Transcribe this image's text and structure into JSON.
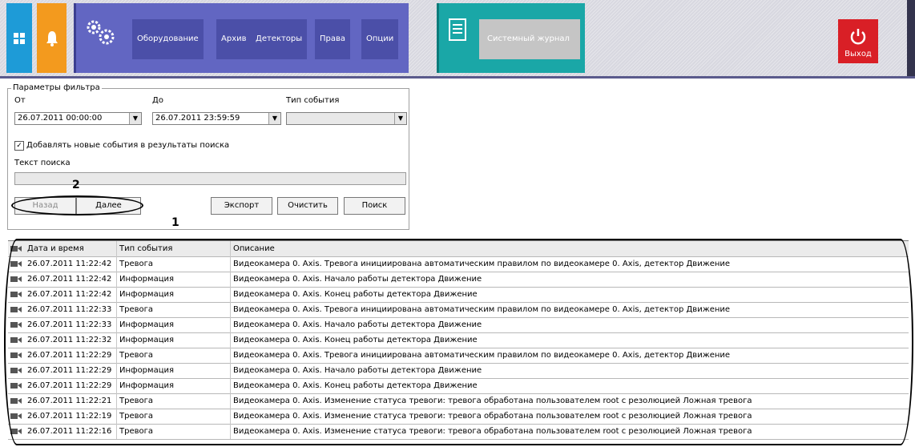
{
  "topbar": {
    "menu": [
      "Оборудование",
      "Архив",
      "Детекторы",
      "Права",
      "Опции"
    ],
    "journal_label": "Системный журнал",
    "exit_label": "Выход",
    "colors": {
      "grid_tile": "#1e9bd7",
      "bell_tile": "#f39a1e",
      "menu_group": "#6266c2",
      "journal_group": "#1aa7a7",
      "exit": "#d91f26"
    }
  },
  "filter": {
    "legend": "Параметры фильтра",
    "from_label": "От",
    "to_label": "До",
    "type_label": "Тип события",
    "from_value": "26.07.2011 00:00:00",
    "to_value": "26.07.2011 23:59:59",
    "type_value": "",
    "append_checked": true,
    "append_label": "Добавлять новые события в результаты поиска",
    "search_label": "Текст поиска",
    "search_value": "",
    "buttons": {
      "back": "Назад",
      "next": "Далее",
      "export": "Экспорт",
      "clear": "Очистить",
      "search": "Поиск"
    }
  },
  "callouts": {
    "one": "1",
    "two": "2"
  },
  "table": {
    "columns": [
      "Дата и время",
      "Тип события",
      "Описание"
    ],
    "rows": [
      [
        "26.07.2011 11:22:42",
        "Тревога",
        "Видеокамера 0. Axis. Тревога инициирована автоматическим правилом по видеокамере 0. Axis, детектор Движение"
      ],
      [
        "26.07.2011 11:22:42",
        "Информация",
        "Видеокамера 0. Axis. Начало работы детектора Движение"
      ],
      [
        "26.07.2011 11:22:42",
        "Информация",
        "Видеокамера 0. Axis. Конец работы детектора Движение"
      ],
      [
        "26.07.2011 11:22:33",
        "Тревога",
        "Видеокамера 0. Axis. Тревога инициирована автоматическим правилом по видеокамере 0. Axis, детектор Движение"
      ],
      [
        "26.07.2011 11:22:33",
        "Информация",
        "Видеокамера 0. Axis. Начало работы детектора Движение"
      ],
      [
        "26.07.2011 11:22:32",
        "Информация",
        "Видеокамера 0. Axis. Конец работы детектора Движение"
      ],
      [
        "26.07.2011 11:22:29",
        "Тревога",
        "Видеокамера 0. Axis. Тревога инициирована автоматическим правилом по видеокамере 0. Axis, детектор Движение"
      ],
      [
        "26.07.2011 11:22:29",
        "Информация",
        "Видеокамера 0. Axis. Начало работы детектора Движение"
      ],
      [
        "26.07.2011 11:22:29",
        "Информация",
        "Видеокамера 0. Axis. Конец работы детектора Движение"
      ],
      [
        "26.07.2011 11:22:21",
        "Тревога",
        "Видеокамера 0. Axis. Изменение статуса тревоги: тревога обработана  пользователем root с резолюцией Ложная тревога"
      ],
      [
        "26.07.2011 11:22:19",
        "Тревога",
        "Видеокамера 0. Axis. Изменение статуса тревоги: тревога обработана  пользователем root с резолюцией Ложная тревога"
      ],
      [
        "26.07.2011 11:22:16",
        "Тревога",
        "Видеокамера 0. Axis. Изменение статуса тревоги: тревога обработана  пользователем root с резолюцией Ложная тревога"
      ]
    ]
  }
}
